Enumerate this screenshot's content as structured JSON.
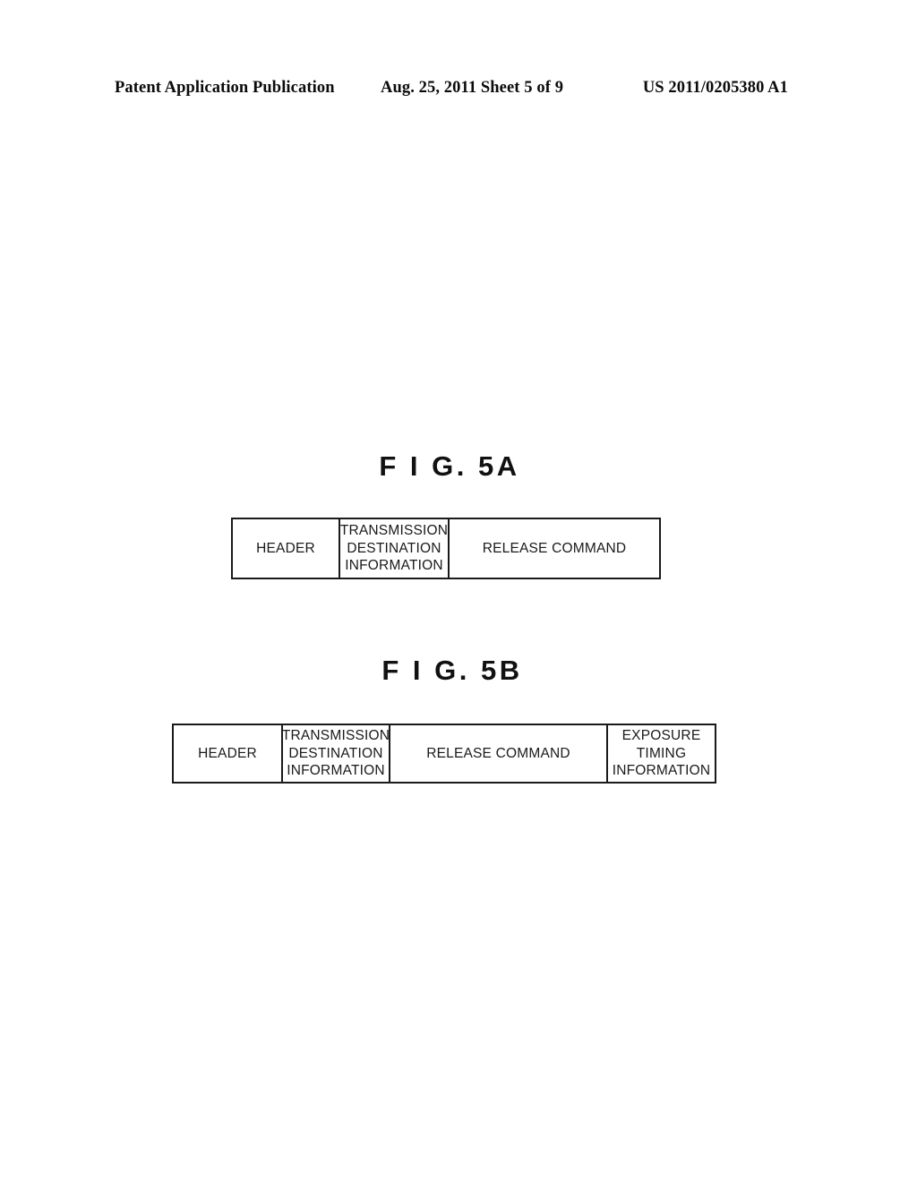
{
  "header": {
    "publication": "Patent Application Publication",
    "date_sheet": "Aug. 25, 2011  Sheet 5 of 9",
    "patent_number": "US 2011/0205380 A1"
  },
  "figures": [
    {
      "title": "F I G.  5A",
      "cells": [
        "HEADER",
        "TRANSMISSION DESTINATION INFORMATION",
        "RELEASE COMMAND"
      ]
    },
    {
      "title": "F I G.  5B",
      "cells": [
        "HEADER",
        "TRANSMISSION DESTINATION INFORMATION",
        "RELEASE COMMAND",
        "EXPOSURE TIMING INFORMATION"
      ]
    }
  ]
}
